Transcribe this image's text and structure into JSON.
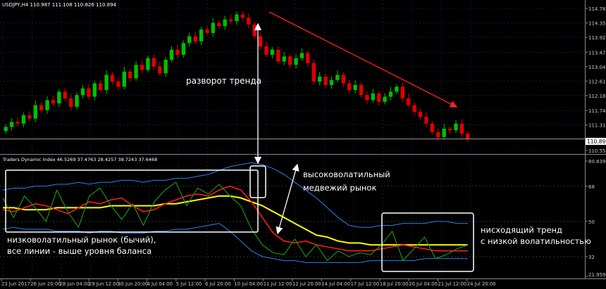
{
  "window": {
    "symbol_header": "USDJPY,H4  110.987 111.108 110.826 110.894",
    "indicator_header": "Traders Dynamic Index 46.5269 37.4763 28.4257 38.7243 37.6468"
  },
  "colors": {
    "background": "#000000",
    "bull_candle": "#00c000",
    "bear_candle": "#e00000",
    "grid": "#1e2a44",
    "axis_text": "#c8c8c8",
    "band": "#2f7fe8",
    "mid": "#ffff00",
    "signal": "#ff1a1a",
    "rsi": "#1a9e1a",
    "annotation": "#ffffff",
    "trend_arrow": "#ff2020"
  },
  "chart_data": [
    {
      "type": "candlestick",
      "title": "USDJPY,H4",
      "ohlc_header": [
        110.987,
        111.108,
        110.826,
        110.894
      ],
      "y_ticks": [
        "114.780",
        "114.350",
        "113.920",
        "113.475",
        "113.045",
        "112.615",
        "112.185",
        "111.740",
        "111.310",
        "110.894",
        "110.550"
      ],
      "current_price": "110.894",
      "ylim": [
        110.55,
        114.78
      ],
      "closes": [
        111.25,
        111.4,
        111.35,
        111.6,
        111.5,
        111.9,
        111.75,
        112.05,
        111.95,
        112.3,
        112.1,
        111.85,
        112.2,
        112.4,
        112.15,
        112.55,
        112.35,
        112.8,
        112.6,
        112.45,
        112.9,
        112.7,
        113.1,
        112.95,
        113.3,
        113.05,
        112.85,
        113.25,
        113.55,
        113.4,
        113.75,
        113.95,
        113.8,
        114.15,
        114.05,
        114.35,
        114.25,
        114.45,
        114.4,
        114.6,
        114.5,
        114.3,
        113.95,
        113.65,
        113.4,
        113.55,
        113.2,
        113.35,
        113.1,
        113.3,
        113.45,
        113.15,
        112.6,
        112.75,
        112.5,
        112.65,
        112.8,
        112.55,
        112.35,
        112.5,
        112.2,
        112.05,
        112.25,
        112.0,
        112.15,
        112.3,
        112.45,
        112.1,
        111.9,
        111.7,
        111.55,
        111.35,
        111.1,
        110.95,
        111.2,
        111.15,
        111.35,
        111.05,
        110.89
      ]
    },
    {
      "type": "line",
      "title": "Traders Dynamic Index",
      "values_header": [
        46.5269,
        37.4763,
        28.4257,
        38.7243,
        37.6468
      ],
      "y_ticks": [
        "80.839",
        "68",
        "50",
        "32",
        "21.9596"
      ],
      "ylim": [
        21.9596,
        80.839
      ],
      "series": [
        {
          "key": "upper_band",
          "values": [
            66,
            67,
            67,
            68,
            68,
            69,
            69,
            70,
            69,
            70,
            70,
            71,
            71,
            70,
            71,
            71,
            72,
            72,
            73,
            74,
            76,
            78,
            79,
            80,
            79,
            77,
            74,
            70,
            66,
            62,
            57,
            52,
            48,
            47,
            47,
            48,
            48,
            49,
            49,
            49,
            50,
            50,
            49,
            49
          ]
        },
        {
          "key": "lower_band",
          "values": [
            46,
            47,
            46,
            46,
            46,
            45,
            45,
            45,
            44,
            45,
            45,
            44,
            44,
            44,
            45,
            45,
            46,
            46,
            47,
            48,
            49,
            45,
            40,
            35,
            32,
            31,
            30,
            30,
            29,
            29,
            29,
            29,
            29,
            29,
            30,
            30,
            30,
            30,
            30,
            31,
            31,
            31,
            31,
            31
          ]
        },
        {
          "key": "market_base",
          "values": [
            57,
            57,
            56,
            56,
            56,
            57,
            57,
            57,
            57,
            57,
            58,
            58,
            58,
            58,
            58,
            59,
            59,
            60,
            61,
            62,
            63,
            63,
            62,
            60,
            58,
            55,
            52,
            49,
            46,
            43,
            42,
            40,
            39,
            39,
            38,
            38,
            38,
            38,
            38,
            38,
            38,
            38,
            38,
            38
          ]
        },
        {
          "key": "signal",
          "values": [
            56,
            55,
            57,
            59,
            58,
            56,
            54,
            57,
            60,
            59,
            61,
            62,
            58,
            55,
            56,
            59,
            61,
            63,
            64,
            63,
            66,
            68,
            66,
            60,
            52,
            44,
            40,
            39,
            40,
            38,
            37,
            36,
            35,
            35,
            35,
            36,
            37,
            38,
            37,
            36,
            35,
            35,
            35,
            35
          ]
        },
        {
          "key": "rsi",
          "values": [
            62,
            52,
            63,
            57,
            50,
            66,
            55,
            47,
            63,
            67,
            58,
            51,
            59,
            48,
            60,
            66,
            70,
            58,
            67,
            64,
            69,
            63,
            58,
            46,
            38,
            34,
            33,
            41,
            32,
            38,
            30,
            35,
            32,
            34,
            33,
            38,
            45,
            30,
            36,
            42,
            31,
            33,
            36,
            38
          ]
        }
      ],
      "levels": [
        68,
        50,
        32
      ]
    }
  ],
  "x_axis": [
    "23 Jun 2017",
    "26 Jun 20:00",
    "28 Jun 04:00",
    "29 Jun 12:00",
    "30 Jun 20:00",
    "4 Jul 04:00",
    "5 Jul 12:00",
    "6 Jul 20:00",
    "10 Jul 04:00",
    "11 Jul 12:00",
    "12 Jul 20:00",
    "14 Jul 04:00",
    "17 Jul 12:00",
    "18 Jul 20:00",
    "20 Jul 04:00",
    "21 Jul 12:00",
    "24 Jul 20:00"
  ],
  "annotations": {
    "trend_reversal": "разворот тренда",
    "high_vol_1": "высоковолатильный",
    "high_vol_2": "медвежий рынок",
    "low_vol_1": "низковолатильный рынок (бычий),",
    "low_vol_2": "все линии - выше уровня баланса",
    "down_trend_1": "нисходящий тренд",
    "down_trend_2": "с низкой волатильностью"
  }
}
